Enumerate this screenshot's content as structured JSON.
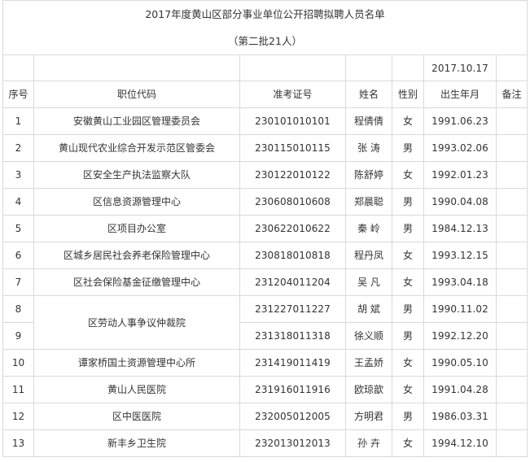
{
  "title": "2017年度黄山区部分事业单位公开招聘拟聘人员名单",
  "subtitle": "（第二批21人）",
  "date": "2017.10.17",
  "headers": {
    "no": "序号",
    "unit": "职位代码",
    "exam_id": "准考证号",
    "name": "姓名",
    "gender": "性别",
    "birth": "出生年月",
    "remark": "备注"
  },
  "rows": [
    {
      "no": "1",
      "unit": "安徽黄山工业园区管理委员会",
      "exam_id": "230101010101",
      "name": "程倩倩",
      "gender": "女",
      "birth": "1991.06.23",
      "remark": ""
    },
    {
      "no": "2",
      "unit": "黄山现代农业综合开发示范区管委会",
      "exam_id": "230115010115",
      "name": "张 涛",
      "gender": "男",
      "birth": "1993.02.06",
      "remark": ""
    },
    {
      "no": "3",
      "unit": "区安全生产执法监察大队",
      "exam_id": "230122010122",
      "name": "陈舒婷",
      "gender": "女",
      "birth": "1992.01.23",
      "remark": ""
    },
    {
      "no": "4",
      "unit": "区信息资源管理中心",
      "exam_id": "230608010608",
      "name": "郑晨聪",
      "gender": "男",
      "birth": "1990.04.08",
      "remark": ""
    },
    {
      "no": "5",
      "unit": "区项目办公室",
      "exam_id": "230622010622",
      "name": "秦 岭",
      "gender": "男",
      "birth": "1984.12.13",
      "remark": ""
    },
    {
      "no": "6",
      "unit": "区城乡居民社会养老保险管理中心",
      "exam_id": "230818010818",
      "name": "程丹凤",
      "gender": "女",
      "birth": "1993.12.15",
      "remark": ""
    },
    {
      "no": "7",
      "unit": "区社会保险基金征缴管理中心",
      "exam_id": "231204011204",
      "name": "吴 凡",
      "gender": "女",
      "birth": "1993.04.18",
      "remark": ""
    },
    {
      "no": "8",
      "unit": "区劳动人事争议仲裁院",
      "exam_id": "231227011227",
      "name": "胡 斌",
      "gender": "男",
      "birth": "1990.11.02",
      "remark": ""
    },
    {
      "no": "9",
      "unit": "",
      "exam_id": "231318011318",
      "name": "徐义顺",
      "gender": "男",
      "birth": "1992.12.20",
      "remark": ""
    },
    {
      "no": "10",
      "unit": "谭家桥国土资源管理中心所",
      "exam_id": "231419011419",
      "name": "王孟娇",
      "gender": "女",
      "birth": "1990.05.10",
      "remark": ""
    },
    {
      "no": "11",
      "unit": "黄山人民医院",
      "exam_id": "231916011916",
      "name": "欧琼歆",
      "gender": "女",
      "birth": "1991.04.28",
      "remark": ""
    },
    {
      "no": "12",
      "unit": "区中医医院",
      "exam_id": "232005012005",
      "name": "方明君",
      "gender": "男",
      "birth": "1986.03.31",
      "remark": ""
    },
    {
      "no": "13",
      "unit": "新丰乡卫生院",
      "exam_id": "232013012013",
      "name": "孙 卉",
      "gender": "女",
      "birth": "1994.12.10",
      "remark": ""
    }
  ]
}
